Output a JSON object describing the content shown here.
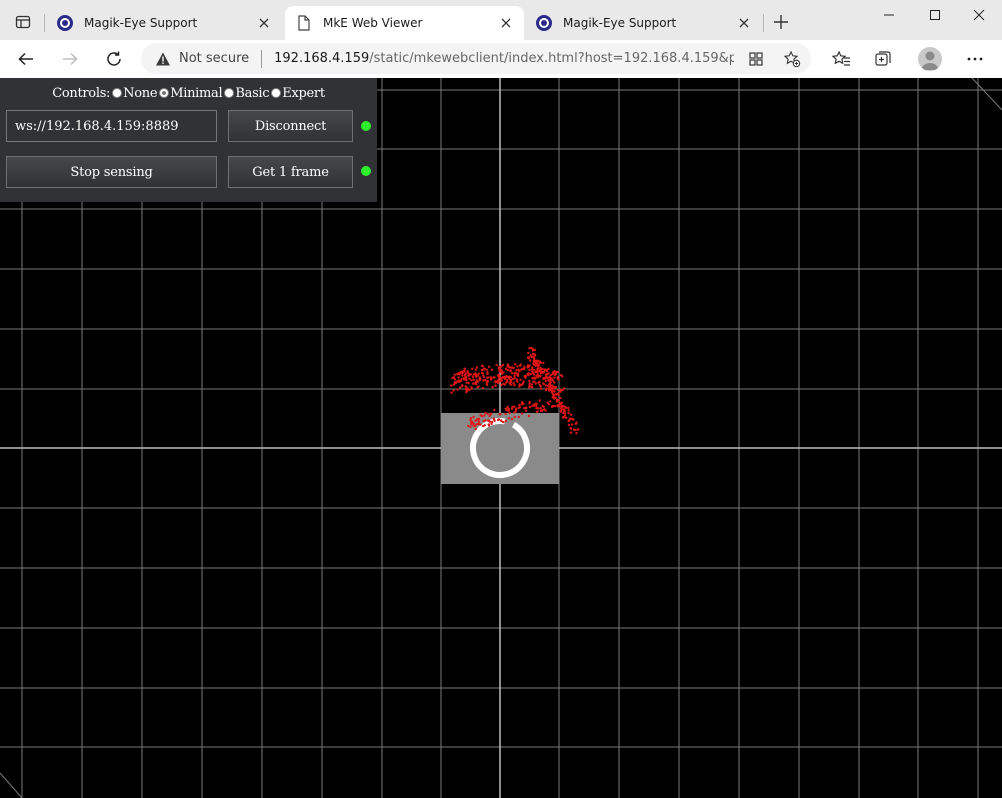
{
  "browser": {
    "tabs": [
      {
        "label": "Magik-Eye Support",
        "active": false
      },
      {
        "label": "MkE Web Viewer",
        "active": true
      },
      {
        "label": "Magik-Eye Support",
        "active": false
      }
    ],
    "address": {
      "security_label": "Not secure",
      "url_host": "192.168.4.159",
      "url_rest": "/static/mkewebclient/index.html?host=192.168.4.159&port..."
    },
    "icons": {
      "tab_actions": "tab-actions-icon",
      "favicon_support": "magik-eye-logo-icon",
      "favicon_viewer": "page-icon",
      "back": "back-arrow-icon",
      "forward": "forward-arrow-icon",
      "refresh": "refresh-icon",
      "warning": "warning-icon",
      "apps": "apps-icon",
      "add_favorite": "add-favorite-icon",
      "favorites": "favorites-icon",
      "collections": "collections-icon",
      "profile": "profile-avatar",
      "more": "more-icon"
    }
  },
  "viewer": {
    "controls": {
      "label": "Controls:",
      "options": [
        "None",
        "Minimal",
        "Basic",
        "Expert"
      ],
      "selected": "Minimal"
    },
    "ws_url": "ws://192.168.4.159:8889",
    "disconnect_label": "Disconnect",
    "stop_sensing_label": "Stop sensing",
    "get_frame_label": "Get 1 frame",
    "status_color": "#2cf02c",
    "point_color": "#e01616",
    "grid_color": "#7a7a7a",
    "axis_color": "#bdbdbd"
  }
}
